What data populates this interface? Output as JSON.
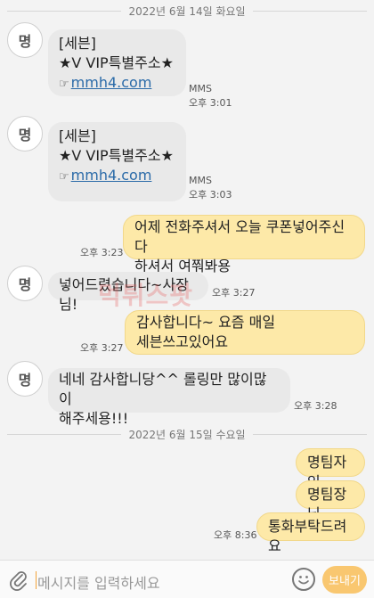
{
  "dates": {
    "first": "2022년 6월 14일 화요일",
    "second": "2022년 6월 15일 수요일"
  },
  "messages": [
    {
      "from": "in",
      "avatar": "명",
      "lines": [
        "[세븐]",
        "★V VIP특별주소★",
        "mmh4.com"
      ],
      "type": "MMS",
      "time": "오후 3:01"
    },
    {
      "from": "in",
      "avatar": "명",
      "lines": [
        "[세븐]",
        "★V VIP특별주소★",
        "mmh4.com"
      ],
      "type": "MMS",
      "time": "오후 3:03"
    },
    {
      "from": "out",
      "lines": [
        "어제 전화주셔서 오늘 쿠폰넣어주신다",
        "하셔서 여쭤봐용"
      ],
      "time": "오후 3:23"
    },
    {
      "from": "in",
      "avatar": "명",
      "lines": [
        "넣어드렸습니다~사장님!"
      ],
      "time": "오후 3:27"
    },
    {
      "from": "out",
      "lines": [
        "감사합니다~ 요즘 매일",
        "세븐쓰고있어요"
      ],
      "time": "오후 3:27"
    },
    {
      "from": "in",
      "avatar": "명",
      "lines": [
        "네네 감사합니당^^ 롤링만 많이많이",
        "해주세용!!!"
      ],
      "time": "오후 3:28"
    },
    {
      "from": "out",
      "lines": [
        "명팀자인"
      ]
    },
    {
      "from": "out",
      "lines": [
        "명팀장님"
      ]
    },
    {
      "from": "out",
      "lines": [
        "통화부탁드려요"
      ],
      "time": "오후 8:36"
    }
  ],
  "watermark": "먹튀스팟",
  "input": {
    "placeholder": "메시지를 입력하세요",
    "send_label": "보내기"
  },
  "icons": {
    "attach": "paperclip-icon",
    "emoji": "emoji-icon",
    "link": "hand-pointing-icon"
  }
}
